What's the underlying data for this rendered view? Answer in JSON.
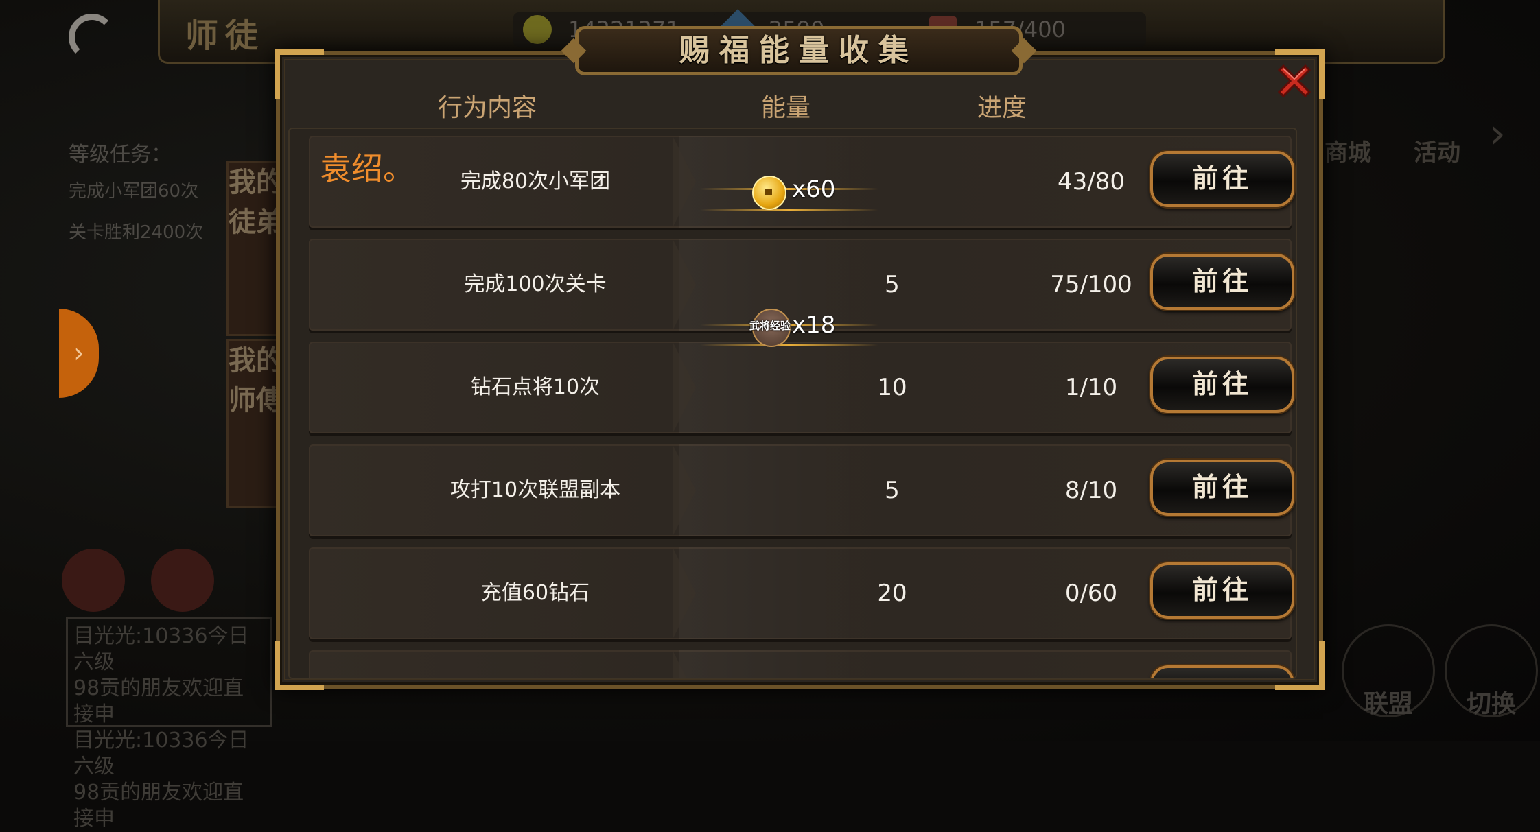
{
  "background": {
    "title": "师徒",
    "stats": [
      "14221271",
      "2590",
      "157/400"
    ],
    "side_tabs": [
      "我的徒弟",
      "我的师傅"
    ],
    "level_task_label": "等级任务：",
    "level_task_items": [
      "完成小军团60次",
      "关卡胜利2400次"
    ],
    "chat_lines": [
      "目光光:10336今日六级",
      "98贡的朋友欢迎直接申",
      "目光光:10336今日六级",
      "98贡的朋友欢迎直接申"
    ],
    "right_labels": [
      "商城",
      "活动"
    ],
    "bottom_buttons": [
      "联盟",
      "切换"
    ]
  },
  "dialog": {
    "title": "赐福能量收集",
    "close_icon": "close-x-icon",
    "columns": {
      "task": "行为内容",
      "energy": "能量",
      "progress": "进度"
    },
    "hero_name": "袁绍。",
    "rows": [
      {
        "task": "完成80次小军团",
        "energy": "",
        "progress": "43/80",
        "button": "前往"
      },
      {
        "task": "完成100次关卡",
        "energy": "5",
        "progress": "75/100",
        "button": "前往"
      },
      {
        "task": "钻石点将10次",
        "energy": "10",
        "progress": "1/10",
        "button": "前往"
      },
      {
        "task": "攻打10次联盟副本",
        "energy": "5",
        "progress": "8/10",
        "button": "前往"
      },
      {
        "task": "充值60钻石",
        "energy": "20",
        "progress": "0/60",
        "button": "前往"
      }
    ],
    "rewards": [
      {
        "icon": "gold-coin-icon",
        "label": "",
        "qty": "x60"
      },
      {
        "icon": "general-exp-icon",
        "label": "武将经验",
        "qty": "x18"
      }
    ]
  },
  "colors": {
    "accent": "#f08d2c",
    "header": "#caa473",
    "frame": "#d2a450",
    "close": "#c92b1f"
  }
}
